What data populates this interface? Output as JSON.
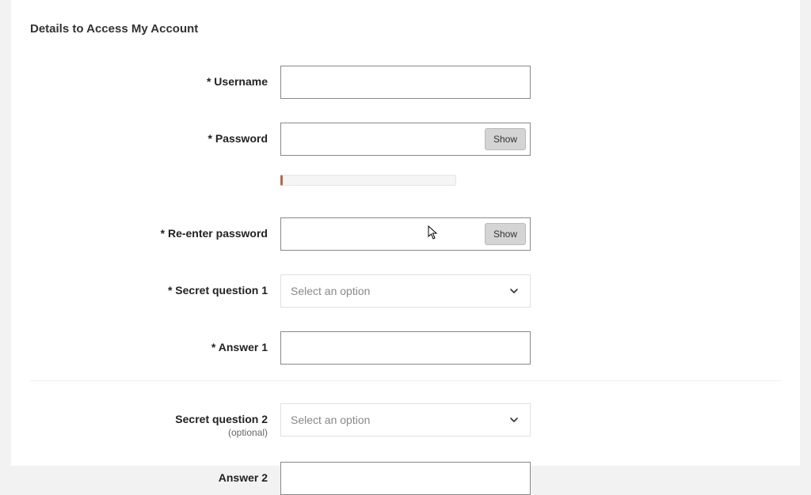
{
  "section_title": "Details to Access My Account",
  "required_mark": "*",
  "fields": {
    "username": {
      "label": "Username",
      "value": ""
    },
    "password": {
      "label": "Password",
      "value": "",
      "show_label": "Show"
    },
    "reenter_password": {
      "label": "Re-enter password",
      "value": "",
      "show_label": "Show"
    },
    "secret_q1": {
      "label": "Secret question 1",
      "placeholder": "Select an option"
    },
    "answer1": {
      "label": "Answer 1",
      "value": ""
    },
    "secret_q2": {
      "label": "Secret question 2",
      "optional_label": "(optional)",
      "placeholder": "Select an option"
    },
    "answer2": {
      "label": "Answer 2",
      "value": ""
    }
  }
}
